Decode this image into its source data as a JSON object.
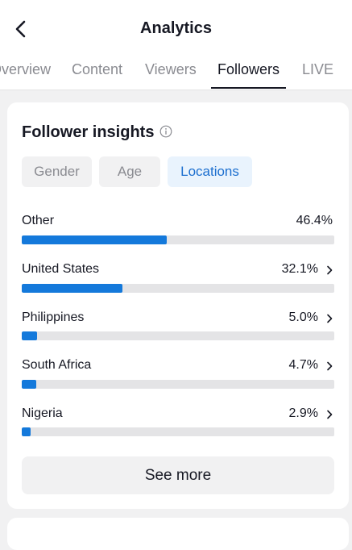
{
  "header": {
    "title": "Analytics"
  },
  "tabs": [
    {
      "label": "Overview",
      "active": false
    },
    {
      "label": "Content",
      "active": false
    },
    {
      "label": "Viewers",
      "active": false
    },
    {
      "label": "Followers",
      "active": true
    },
    {
      "label": "LIVE",
      "active": false
    }
  ],
  "insights": {
    "title": "Follower insights",
    "filters": [
      {
        "label": "Gender",
        "active": false
      },
      {
        "label": "Age",
        "active": false
      },
      {
        "label": "Locations",
        "active": true
      }
    ],
    "locations": [
      {
        "name": "Other",
        "value": "46.4%",
        "percent": 46.4,
        "has_chevron": false
      },
      {
        "name": "United States",
        "value": "32.1%",
        "percent": 32.1,
        "has_chevron": true
      },
      {
        "name": "Philippines",
        "value": "5.0%",
        "percent": 5.0,
        "has_chevron": true
      },
      {
        "name": "South Africa",
        "value": "4.7%",
        "percent": 4.7,
        "has_chevron": true
      },
      {
        "name": "Nigeria",
        "value": "2.9%",
        "percent": 2.9,
        "has_chevron": true
      }
    ],
    "see_more_label": "See more"
  },
  "colors": {
    "accent": "#1479db",
    "active_chip_bg": "#e9f3fd",
    "active_chip_text": "#1c6fcf"
  },
  "icons": {
    "back": "chevron-left-icon",
    "info": "info-icon",
    "row_chevron": "chevron-right-icon"
  }
}
